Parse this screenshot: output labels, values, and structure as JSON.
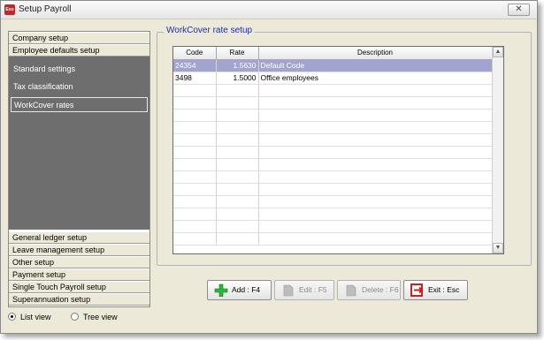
{
  "window": {
    "title": "Setup Payroll",
    "app_badge": "Exo",
    "close_glyph": "✕"
  },
  "sidebar": {
    "headers_top": [
      "Company setup",
      "Employee defaults setup"
    ],
    "items": [
      {
        "label": "Standard settings",
        "selected": false
      },
      {
        "label": "Tax classification",
        "selected": false
      },
      {
        "label": "WorkCover rates",
        "selected": true
      }
    ],
    "headers_bottom": [
      "General ledger setup",
      "Leave management setup",
      "Other setup",
      "Payment setup",
      "Single Touch Payroll setup",
      "Superannuation setup"
    ]
  },
  "view_mode": {
    "options": [
      {
        "label": "List view",
        "selected": true
      },
      {
        "label": "Tree view",
        "selected": false
      }
    ]
  },
  "group": {
    "title": "WorkCover rate setup"
  },
  "grid": {
    "columns": [
      "Code",
      "Rate",
      "Description"
    ],
    "rows": [
      {
        "code": "24354",
        "rate": "1.5630",
        "description": "Default Code",
        "selected": true
      },
      {
        "code": "3498",
        "rate": "1.5000",
        "description": "Office employees",
        "selected": false
      }
    ],
    "selection_color": "#a3a3d0"
  },
  "buttons": {
    "add": {
      "label": "Add : F4",
      "enabled": true
    },
    "edit": {
      "label": "Edit : F5",
      "enabled": false
    },
    "delete": {
      "label": "Delete : F6",
      "enabled": false
    },
    "exit": {
      "label": "Exit : Esc",
      "enabled": true
    }
  },
  "colors": {
    "group_title": "#1d2fa8",
    "panel": "#6e6e6e",
    "add_icon": "#2bb53a",
    "exit_icon": "#cc1f1f"
  }
}
